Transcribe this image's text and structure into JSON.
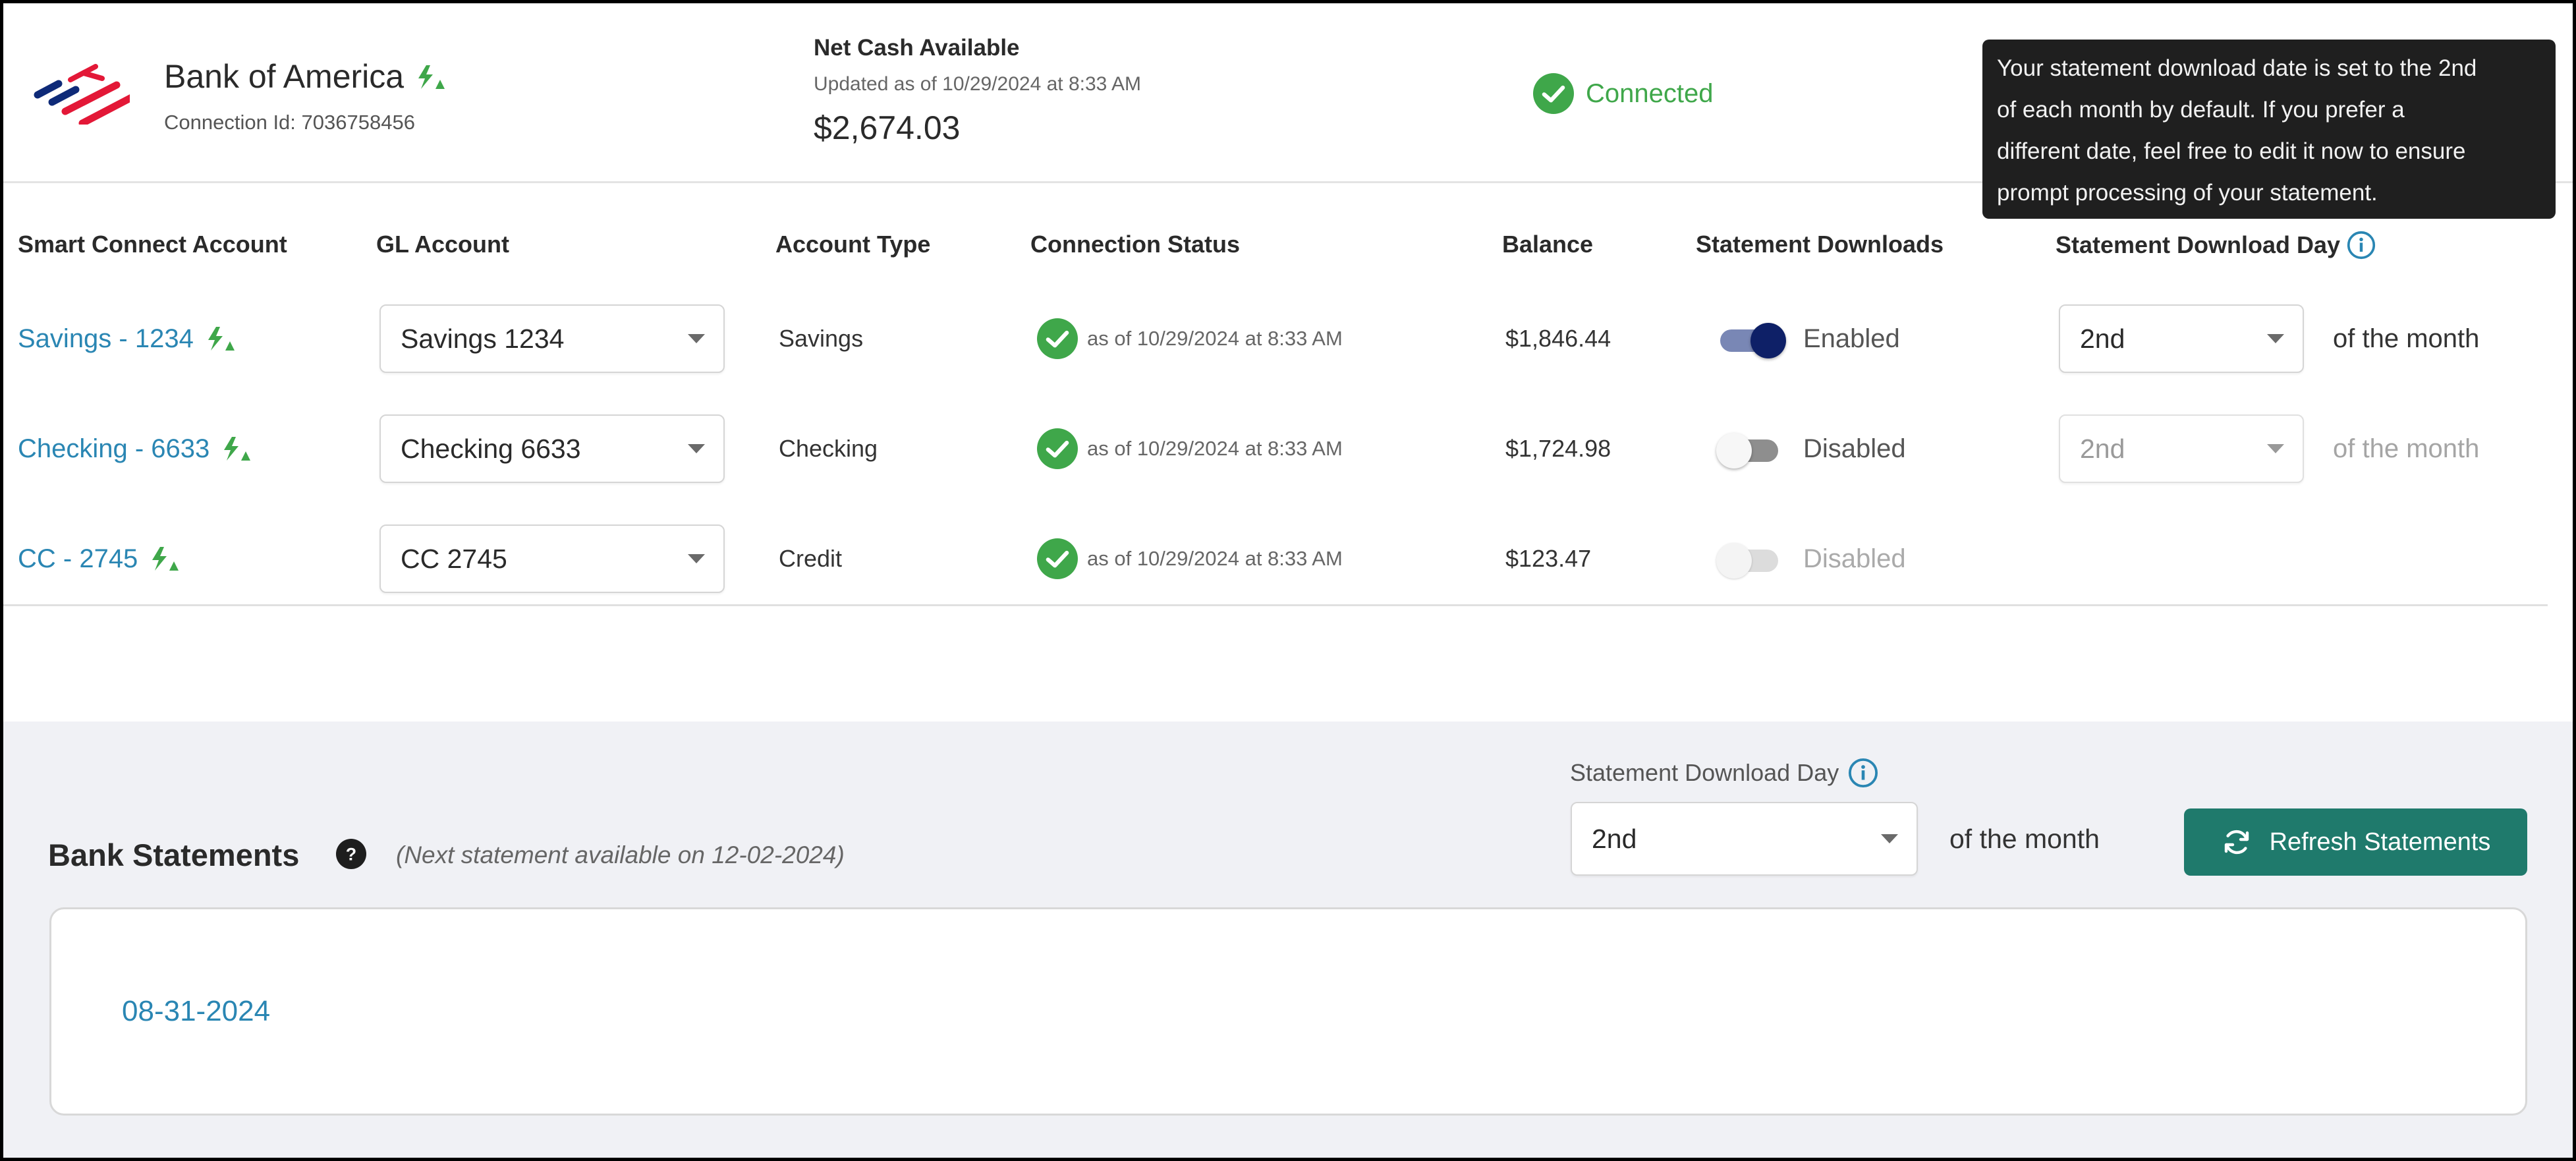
{
  "connection": {
    "bank_name": "Bank of America",
    "connection_id_label": "Connection Id: 7036758456",
    "net_cash_title": "Net Cash Available",
    "net_cash_updated": "Updated as of 10/29/2024 at 8:33 AM",
    "net_cash_amount": "$2,674.03",
    "status_label": "Connected"
  },
  "tooltip": {
    "lines": [
      "Your statement download date is set to the 2nd",
      "of each month by default. If you prefer a",
      "different date, feel free to edit it now to ensure",
      "prompt processing of your statement."
    ]
  },
  "table": {
    "headers": {
      "account": "Smart Connect Account",
      "gl_account": "GL Account",
      "account_type": "Account Type",
      "connection_status": "Connection Status",
      "balance": "Balance",
      "statement_downloads": "Statement Downloads",
      "statement_download_day": "Statement Download Day"
    },
    "rows": [
      {
        "account": "Savings - 1234",
        "gl_account": "Savings 1234",
        "account_type": "Savings",
        "status_text": "as of 10/29/2024 at 8:33 AM",
        "balance": "$1,846.44",
        "downloads_state": "Enabled",
        "download_day": "2nd",
        "of_month": "of the month"
      },
      {
        "account": "Checking - 6633",
        "gl_account": "Checking 6633",
        "account_type": "Checking",
        "status_text": "as of 10/29/2024 at 8:33 AM",
        "balance": "$1,724.98",
        "downloads_state": "Disabled",
        "download_day": "2nd",
        "of_month": "of the month"
      },
      {
        "account": "CC - 2745",
        "gl_account": "CC 2745",
        "account_type": "Credit",
        "status_text": "as of 10/29/2024 at 8:33 AM",
        "balance": "$123.47",
        "downloads_state": "Disabled"
      }
    ]
  },
  "statements": {
    "title": "Bank Statements",
    "next_available": "(Next statement available on 12-02-2024)",
    "download_day_label": "Statement Download Day",
    "download_day_value": "2nd",
    "of_month": "of the month",
    "refresh_label": "Refresh Statements",
    "items": [
      "08-31-2024"
    ]
  },
  "colors": {
    "accent_link": "#2a86b3",
    "success_green": "#3fa74a",
    "toggle_on": "#0e2067",
    "primary_button": "#1f7a6c"
  }
}
